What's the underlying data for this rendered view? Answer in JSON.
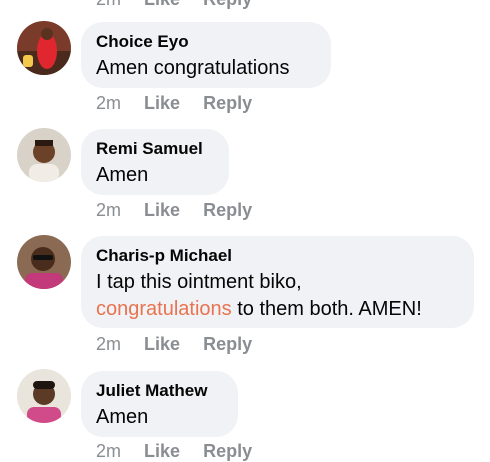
{
  "top_actions": {
    "time": "2m",
    "like": "Like",
    "reply": "Reply"
  },
  "comments": [
    {
      "name": "Choice Eyo",
      "text": "Amen congratulations",
      "time": "2m",
      "like": "Like",
      "reply": "Reply"
    },
    {
      "name": "Remi Samuel",
      "text": "Amen",
      "time": "2m",
      "like": "Like",
      "reply": "Reply"
    },
    {
      "name": "Charis-p Michael",
      "text_line1": "I tap this ointment biko,",
      "mention": "congratulations",
      "text_line2_rest": " to them both. AMEN!",
      "time": "2m",
      "like": "Like",
      "reply": "Reply"
    },
    {
      "name": "Juliet Mathew",
      "text": "Amen",
      "time": "2m",
      "like": "Like",
      "reply": "Reply"
    }
  ],
  "colors": {
    "bubble": "#f0f2f5",
    "muted": "#8a8d91",
    "mention": "#e8734f"
  }
}
